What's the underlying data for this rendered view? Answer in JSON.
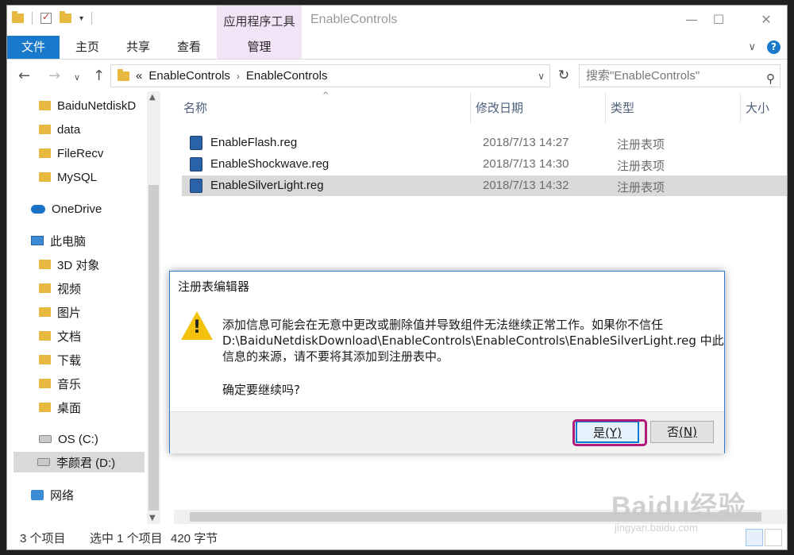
{
  "titlebar": {
    "context_tab": "应用程序工具",
    "window_title": "EnableControls",
    "minimize": "—",
    "maximize": "☐",
    "close": "✕"
  },
  "ribbon": {
    "tabs": [
      "文件",
      "主页",
      "共享",
      "查看",
      "管理"
    ],
    "collapse": "∨",
    "help": "?"
  },
  "address": {
    "prefix": "«",
    "segments": [
      "EnableControls",
      "EnableControls"
    ],
    "separator": "›",
    "dropdown": "∨",
    "refresh": "↻",
    "search_placeholder": "搜索\"EnableControls\"",
    "search_icon": "⚲"
  },
  "nav": {
    "back": "←",
    "forward": "→",
    "recent": "∨",
    "up": "↑",
    "items": [
      {
        "label": "BaiduNetdiskD",
        "icon": "folder-icon"
      },
      {
        "label": "data",
        "icon": "folder-icon"
      },
      {
        "label": "FileRecv",
        "icon": "folder-icon"
      },
      {
        "label": "MySQL",
        "icon": "folder-icon"
      },
      {
        "label": "OneDrive",
        "icon": "cloud-icon"
      },
      {
        "label": "此电脑",
        "icon": "pc-icon"
      },
      {
        "label": "3D 对象",
        "icon": "folder-icon"
      },
      {
        "label": "视频",
        "icon": "folder-icon"
      },
      {
        "label": "图片",
        "icon": "folder-icon"
      },
      {
        "label": "文档",
        "icon": "folder-icon"
      },
      {
        "label": "下载",
        "icon": "folder-icon"
      },
      {
        "label": "音乐",
        "icon": "folder-icon"
      },
      {
        "label": "桌面",
        "icon": "folder-icon"
      },
      {
        "label": "OS (C:)",
        "icon": "drive-icon"
      },
      {
        "label": "李颜君 (D:)",
        "icon": "drive-icon"
      },
      {
        "label": "网络",
        "icon": "network-icon"
      }
    ]
  },
  "files": {
    "columns": [
      "名称",
      "修改日期",
      "类型",
      "大小"
    ],
    "sort_arrow": "^",
    "rows": [
      {
        "name": "EnableFlash.reg",
        "date": "2018/7/13 14:27",
        "type": "注册表项"
      },
      {
        "name": "EnableShockwave.reg",
        "date": "2018/7/13 14:30",
        "type": "注册表项"
      },
      {
        "name": "EnableSilverLight.reg",
        "date": "2018/7/13 14:32",
        "type": "注册表项"
      }
    ]
  },
  "status": {
    "count": "3 个项目",
    "selected": "选中 1 个项目",
    "size": "420 字节"
  },
  "dialog": {
    "title": "注册表编辑器",
    "message_line1": "添加信息可能会在无意中更改或删除值并导致组件无法继续正常工作。如果你不信任",
    "message_line2": "D:\\BaiduNetdiskDownload\\EnableControls\\EnableControls\\EnableSilverLight.reg 中此",
    "message_line3": "信息的来源，请不要将其添加到注册表中。",
    "confirm": "确定要继续吗?",
    "warn_mark": "!",
    "yes_label": "是",
    "yes_key": "(Y)",
    "no_label": "否",
    "no_key": "(N)"
  },
  "watermark": {
    "brand": "Baidu经验",
    "url": "jingyan.baidu.com"
  },
  "colors": {
    "file_tab": "#1979ca",
    "context_tab": "#f3e3f7",
    "warning": "#f4c20d",
    "highlight": "#b01a78"
  }
}
